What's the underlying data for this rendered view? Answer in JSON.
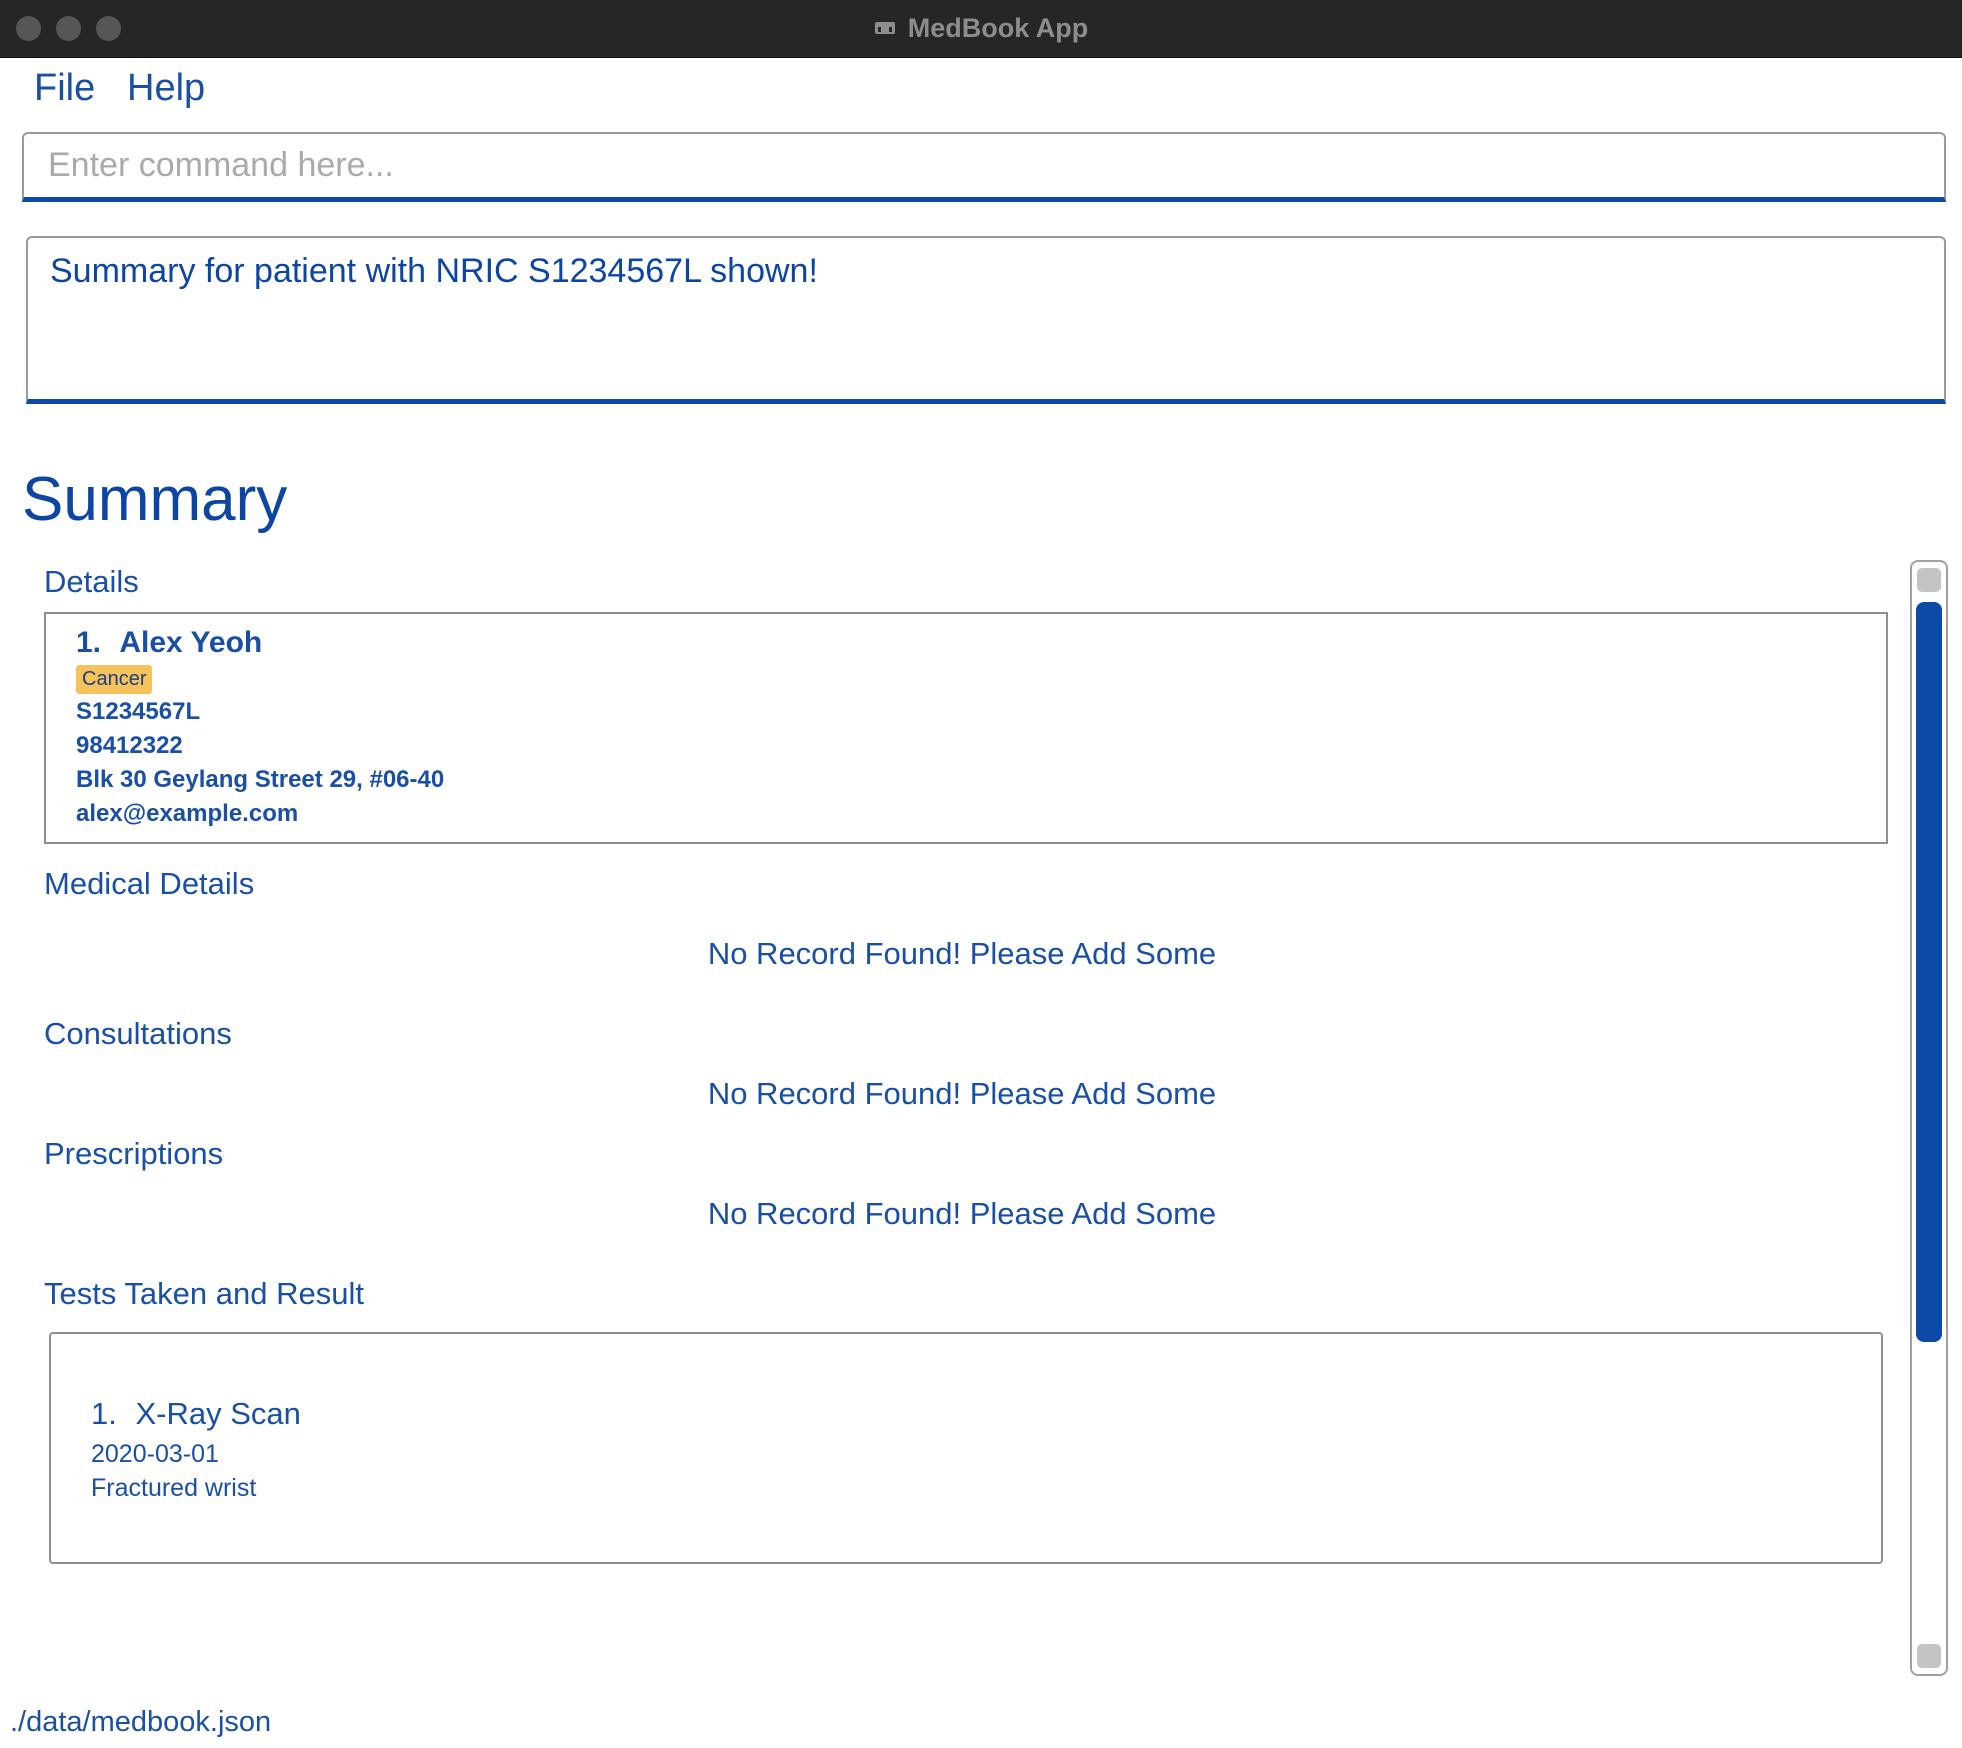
{
  "window": {
    "title": "MedBook App"
  },
  "menu": {
    "file": "File",
    "help": "Help"
  },
  "command": {
    "placeholder": "Enter command here..."
  },
  "result": {
    "message": "Summary for patient with NRIC S1234567L shown!"
  },
  "summary": {
    "title": "Summary",
    "details": {
      "heading": "Details",
      "index": "1.",
      "name": "Alex Yeoh",
      "tag": "Cancer",
      "nric": "S1234567L",
      "phone": "98412322",
      "address": "Blk 30 Geylang Street 29, #06-40",
      "email": "alex@example.com"
    },
    "medical_details": {
      "heading": "Medical Details",
      "empty": "No Record Found! Please Add Some"
    },
    "consultations": {
      "heading": "Consultations",
      "empty": "No Record Found! Please Add Some"
    },
    "prescriptions": {
      "heading": "Prescriptions",
      "empty": "No Record Found! Please Add Some"
    },
    "tests": {
      "heading": "Tests Taken and Result",
      "items": [
        {
          "index": "1.",
          "name": "X-Ray Scan",
          "date": "2020-03-01",
          "result": "Fractured wrist"
        }
      ]
    }
  },
  "status": {
    "path": "./data/medbook.json"
  },
  "colors": {
    "accent": "#0d4aa8",
    "text": "#1a4fa6",
    "tag": "#f6c25c",
    "titlebar": "#262626"
  }
}
